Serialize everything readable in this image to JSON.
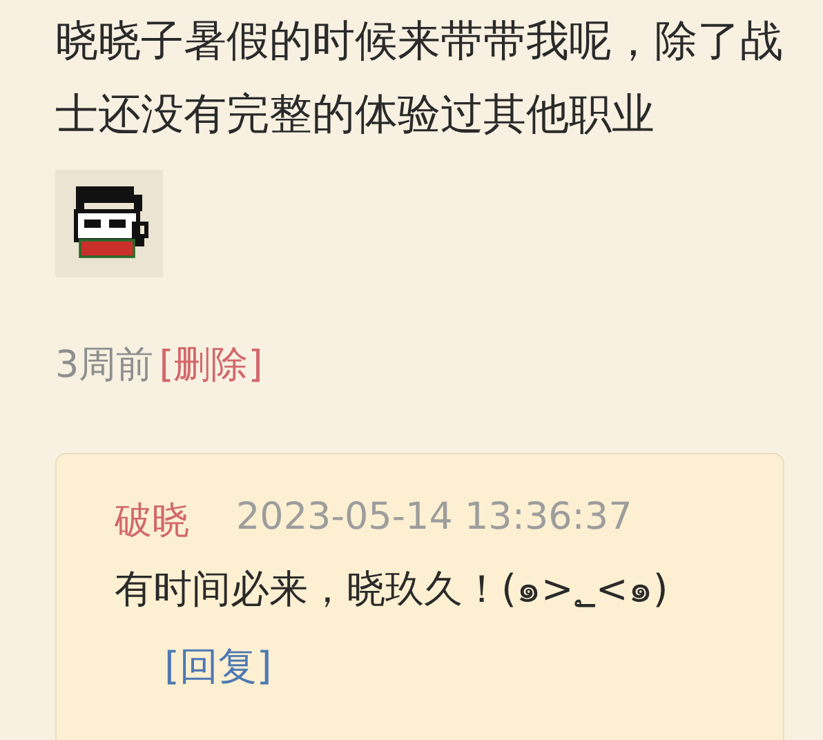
{
  "post": {
    "text": "晓晓子暑假的时候来带带我呢，除了战士还没有完整的体验过其他职业",
    "time": "3周前",
    "delete_link": "[删除]"
  },
  "reply": {
    "author": "破晓",
    "timestamp": "2023-05-14 13:36:37",
    "text": "有时间必来，晓玖久！(๑>؂<๑)",
    "reply_link": "[回复]"
  }
}
